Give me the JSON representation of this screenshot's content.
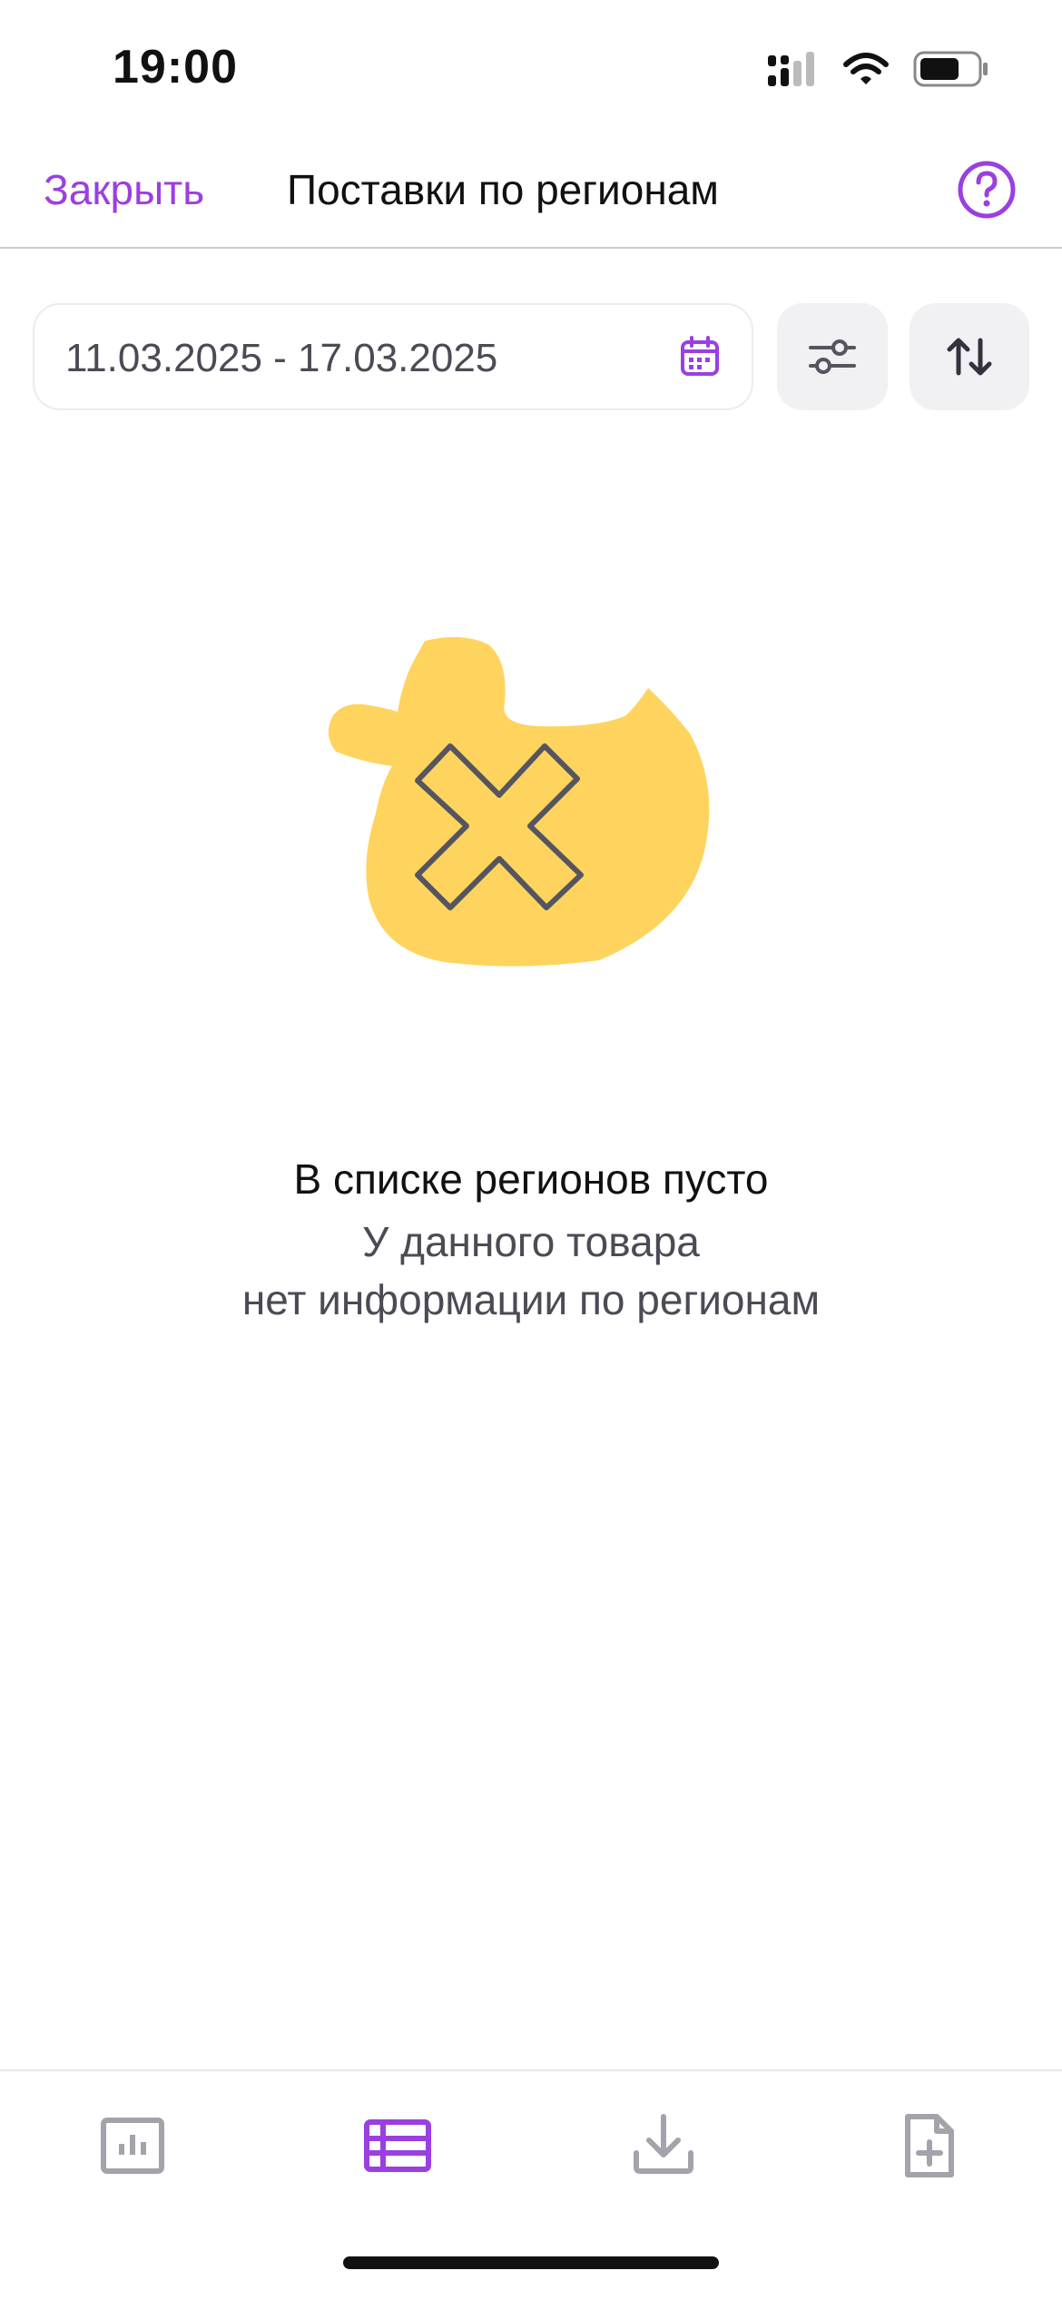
{
  "status_bar": {
    "time": "19:00"
  },
  "header": {
    "close_label": "Закрыть",
    "title": "Поставки по регионам"
  },
  "filters": {
    "date_range": "11.03.2025 - 17.03.2025"
  },
  "empty_state": {
    "title": "В списке регионов пусто",
    "subtitle_line1": "У данного товара",
    "subtitle_line2": "нет информации по регионам"
  },
  "tab_bar": {
    "tabs": [
      {
        "icon": "chart-icon",
        "active": false
      },
      {
        "icon": "table-list-icon",
        "active": true
      },
      {
        "icon": "download-icon",
        "active": false
      },
      {
        "icon": "add-document-icon",
        "active": false
      }
    ]
  },
  "colors": {
    "accent": "#9b3fe0",
    "duck": "#ffd45e",
    "muted_icon": "#a3a3ab"
  }
}
